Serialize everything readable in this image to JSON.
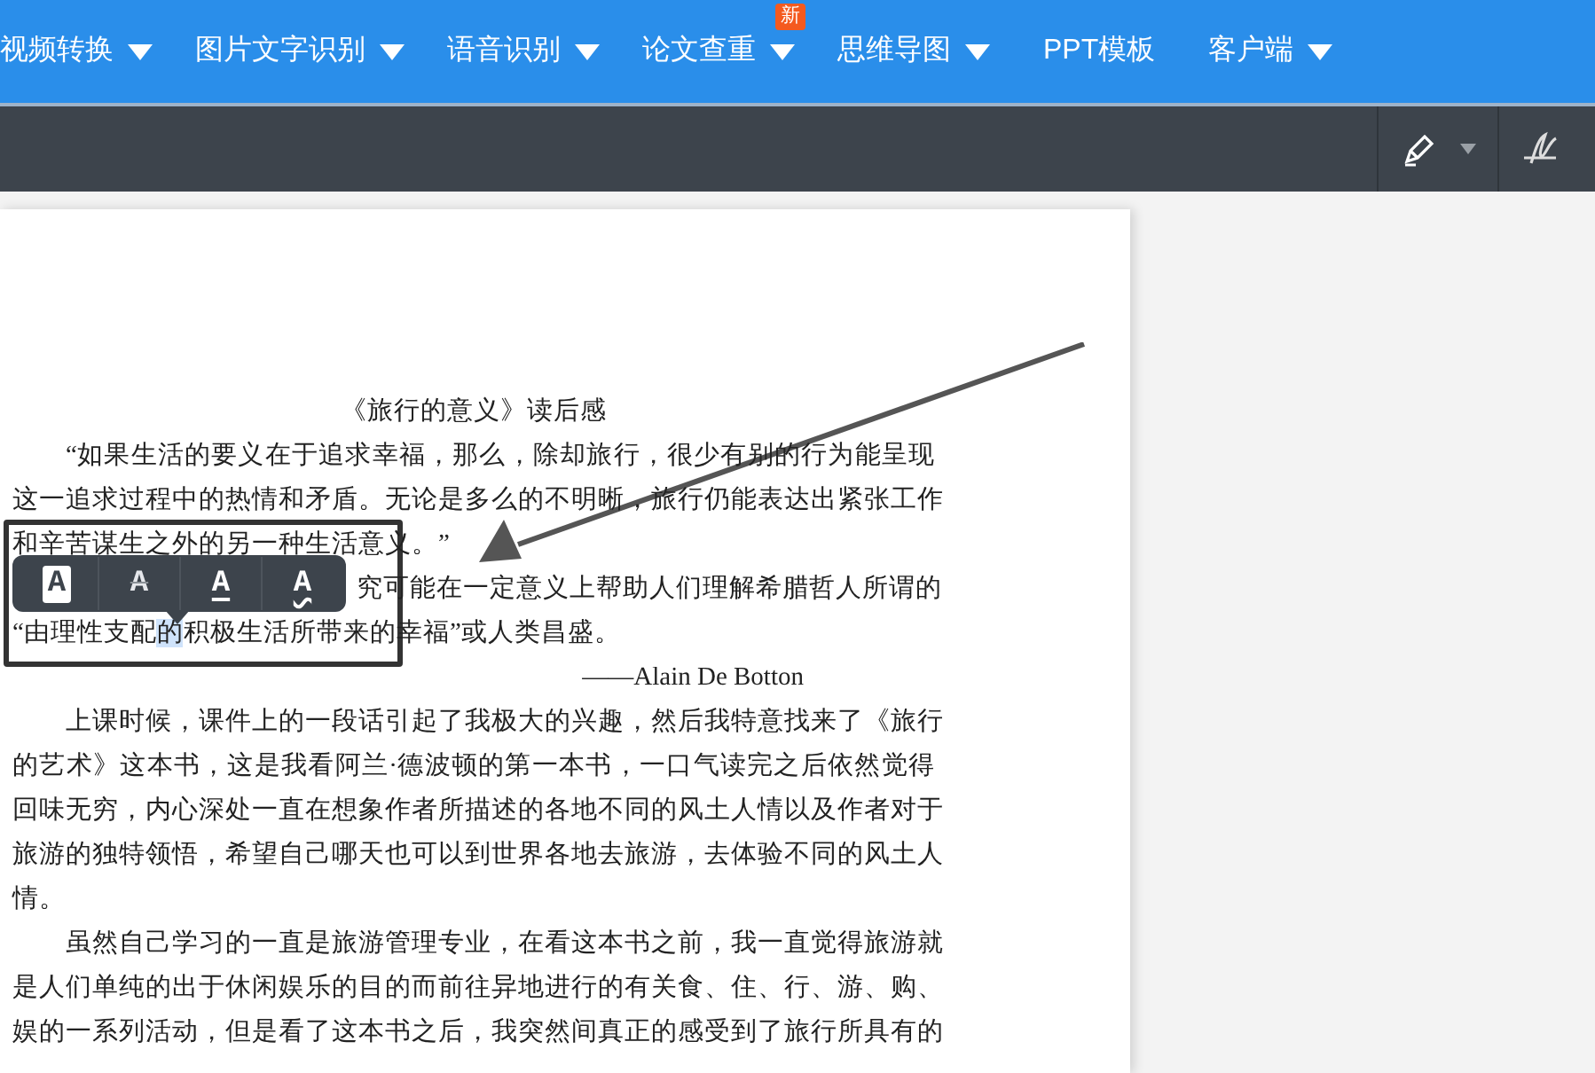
{
  "nav": [
    {
      "label": "视频转换",
      "dropdown": true
    },
    {
      "label": "图片文字识别",
      "dropdown": true
    },
    {
      "label": "语音识别",
      "dropdown": true
    },
    {
      "label": "论文查重",
      "dropdown": true,
      "badge": "新"
    },
    {
      "label": "思维导图",
      "dropdown": true
    },
    {
      "label": "PPT模板",
      "dropdown": false
    },
    {
      "label": "客户端",
      "dropdown": true
    }
  ],
  "document": {
    "title": "《旅行的意义》读后感",
    "paragraphs": [
      {
        "kind": "text",
        "lines": [
          {
            "text": "“如果生活的要义在于追求幸福，那么，除却旅行，很少有别的行为能呈现"
          },
          {
            "text": "这一追求过程中的热情和矛盾。无论是多么的不明晰，旅行仍能表达出紧张工作"
          },
          {
            "text": "和辛苦谋生之外的另一种生活意义。”"
          }
        ]
      },
      {
        "kind": "partial",
        "lines": [
          {
            "text": "究可能在一定意义上帮助人们理解希腊哲人所谓的"
          },
          {
            "segments": [
              {
                "text": "“由理性支配",
                "selected": false
              },
              {
                "text": "的",
                "selected": true
              },
              {
                "text": "积极生活所带来的幸福”或人类昌盛。",
                "selected": false
              }
            ]
          }
        ]
      },
      {
        "kind": "attribution",
        "lines": [
          {
            "text": "——Alain De Botton"
          }
        ]
      },
      {
        "kind": "text",
        "lines": [
          {
            "text": "上课时候，课件上的一段话引起了我极大的兴趣，然后我特意找来了《旅行"
          },
          {
            "text": "的艺术》这本书，这是我看阿兰·德波顿的第一本书，一口气读完之后依然觉得"
          },
          {
            "text": "回味无穷，内心深处一直在想象作者所描述的各地不同的风土人情以及作者对于"
          },
          {
            "text": "旅游的独特领悟，希望自己哪天也可以到世界各地去旅游，去体验不同的风土人"
          },
          {
            "text": "情。"
          }
        ]
      },
      {
        "kind": "text",
        "lines": [
          {
            "text": "虽然自己学习的一直是旅游管理专业，在看这本书之前，我一直觉得旅游就"
          },
          {
            "text": "是人们单纯的出于休闲娱乐的目的而前往异地进行的有关食、住、行、游、购、"
          },
          {
            "text": "娱的一系列活动，但是看了这本书之后，我突然间真正的感受到了旅行所具有的"
          }
        ]
      }
    ]
  },
  "format_toolbar": [
    {
      "kind": "highlight",
      "label": "A"
    },
    {
      "kind": "strikethrough",
      "label": "A"
    },
    {
      "kind": "underline",
      "label": "A"
    },
    {
      "kind": "wavy",
      "label": "A"
    }
  ]
}
